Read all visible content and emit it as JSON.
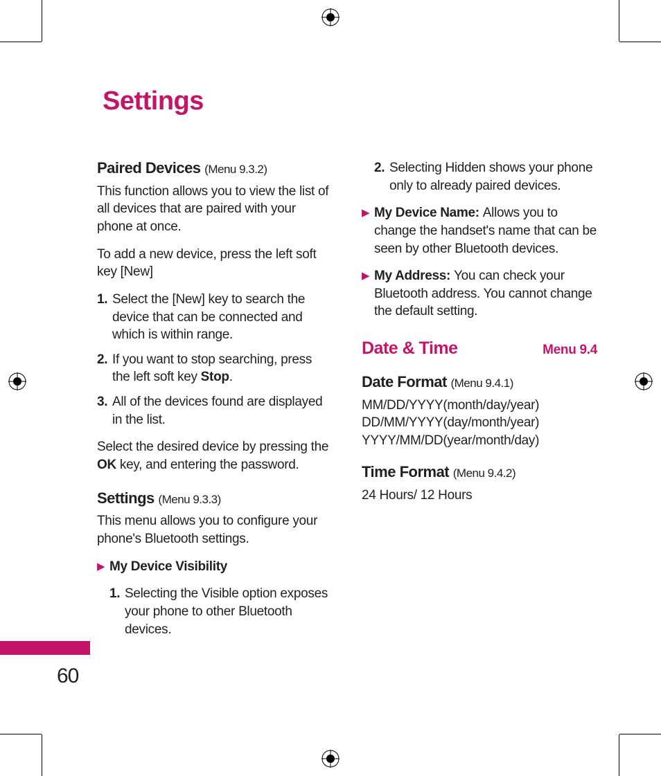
{
  "title": "Settings",
  "page_number": "60",
  "left_col": {
    "paired": {
      "heading": "Paired Devices",
      "menu": "(Menu 9.3.2)",
      "p1": "This function allows you to view the list of all devices that are paired with your phone at once.",
      "p2": "To add a new device, press the left soft key [New]",
      "steps": {
        "n1": "1.",
        "t1": "Select the [New] key to search the device that can be connected and which is within range.",
        "n2": "2.",
        "t2_a": "If you want to stop searching, press the left soft key ",
        "t2_b": "Stop",
        "t2_c": ".",
        "n3": "3.",
        "t3": "All of the devices found are displayed in the list."
      },
      "p3_a": "Select the desired device by pressing the ",
      "p3_b": "OK",
      "p3_c": " key, and entering the password."
    },
    "settings": {
      "heading": "Settings",
      "menu": "(Menu 9.3.3)",
      "p1": "This menu allows you to configure your phone's Bluetooth settings.",
      "vis_label": "My Device Visibility",
      "vis1_n": "1.",
      "vis1_t": "Selecting the Visible option exposes your phone to other Bluetooth devices."
    }
  },
  "right_col": {
    "vis2_n": "2.",
    "vis2_t": "Selecting Hidden shows your phone only to already paired devices.",
    "name_label": "My Device Name: ",
    "name_text": "Allows you to change the handset's name that can be seen by other Bluetooth devices.",
    "addr_label": "My Address: ",
    "addr_text": "You can check your Bluetooth address. You cannot change the default setting.",
    "dt_title": "Date & Time",
    "dt_menu": "Menu 9.4",
    "df_heading": "Date Format",
    "df_menu": "(Menu 9.4.1)",
    "df_l1": "MM/DD/YYYY(month/day/year)",
    "df_l2": "DD/MM/YYYY(day/month/year)",
    "df_l3": "YYYY/MM/DD(year/month/day)",
    "tf_heading": "Time Format",
    "tf_menu": "(Menu 9.4.2)",
    "tf_text": "24 Hours/ 12 Hours"
  }
}
